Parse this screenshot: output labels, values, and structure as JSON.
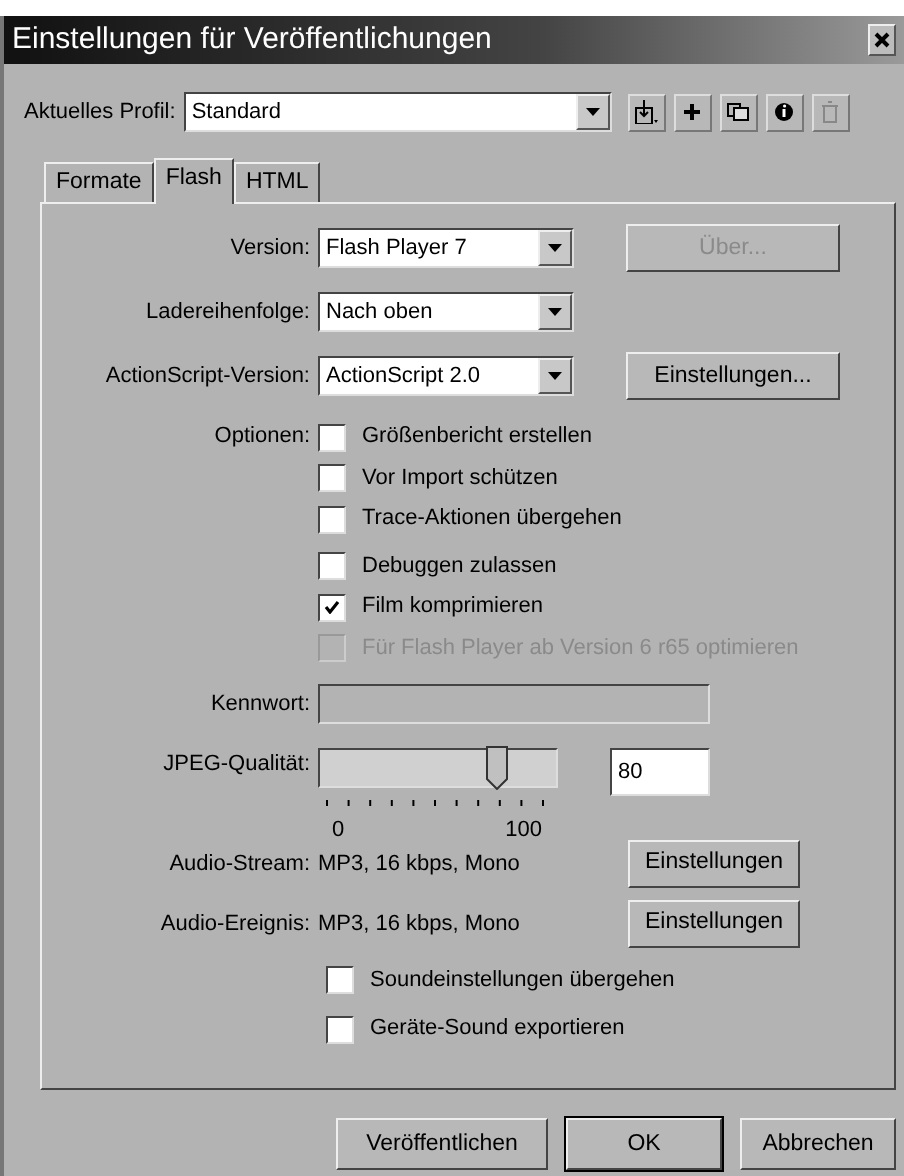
{
  "window": {
    "title": "Einstellungen für Veröffentlichungen"
  },
  "profile": {
    "label": "Aktuelles Profil:",
    "value": "Standard",
    "tools": [
      {
        "kind": "import",
        "disabled": false
      },
      {
        "kind": "add",
        "disabled": false
      },
      {
        "kind": "duplicate",
        "disabled": false
      },
      {
        "kind": "info",
        "disabled": false
      },
      {
        "kind": "delete",
        "disabled": true
      }
    ]
  },
  "tabs": [
    {
      "label": "Formate",
      "selected": false
    },
    {
      "label": "Flash",
      "selected": true
    },
    {
      "label": "HTML",
      "selected": false
    }
  ],
  "selects": [
    {
      "label": "Version:",
      "value": "Flash Player 7",
      "button": {
        "label": "Über...",
        "disabled": true
      }
    },
    {
      "label": "Ladereihenfolge:",
      "value": "Nach oben"
    },
    {
      "label": "ActionScript-Version:",
      "value": "ActionScript 2.0",
      "button": {
        "label": "Einstellungen...",
        "disabled": false
      }
    }
  ],
  "options": {
    "label": "Optionen:",
    "items": [
      {
        "label": "Größenbericht erstellen",
        "checked": false,
        "disabled": false
      },
      {
        "label": "Vor Import schützen",
        "checked": false,
        "disabled": false
      },
      {
        "label": "Trace-Aktionen übergehen",
        "checked": false,
        "disabled": false
      },
      {
        "label": "Debuggen zulassen",
        "checked": false,
        "disabled": false
      },
      {
        "label": "Film komprimieren",
        "checked": true,
        "disabled": false
      },
      {
        "label": "Für Flash Player ab Version 6 r65 optimieren",
        "checked": false,
        "disabled": true
      }
    ]
  },
  "password": {
    "label": "Kennwort:",
    "disabled": true
  },
  "jpeg": {
    "label": "JPEG-Qualität:",
    "level": 0.8,
    "value": "80",
    "min_label": "0",
    "max_label": "100"
  },
  "audio": [
    {
      "label": "Audio-Stream:",
      "value": "MP3, 16 kbps, Mono",
      "button": "Einstellungen"
    },
    {
      "label": "Audio-Ereignis:",
      "value": "MP3, 16 kbps, Mono",
      "button": "Einstellungen"
    }
  ],
  "sound_options": [
    {
      "label": "Soundeinstellungen übergehen",
      "checked": false
    },
    {
      "label": "Geräte-Sound exportieren",
      "checked": false
    }
  ],
  "footer_buttons": [
    {
      "label": "Veröffentlichen",
      "default": false
    },
    {
      "label": "OK",
      "default": true
    },
    {
      "label": "Abbrechen",
      "default": false
    }
  ]
}
